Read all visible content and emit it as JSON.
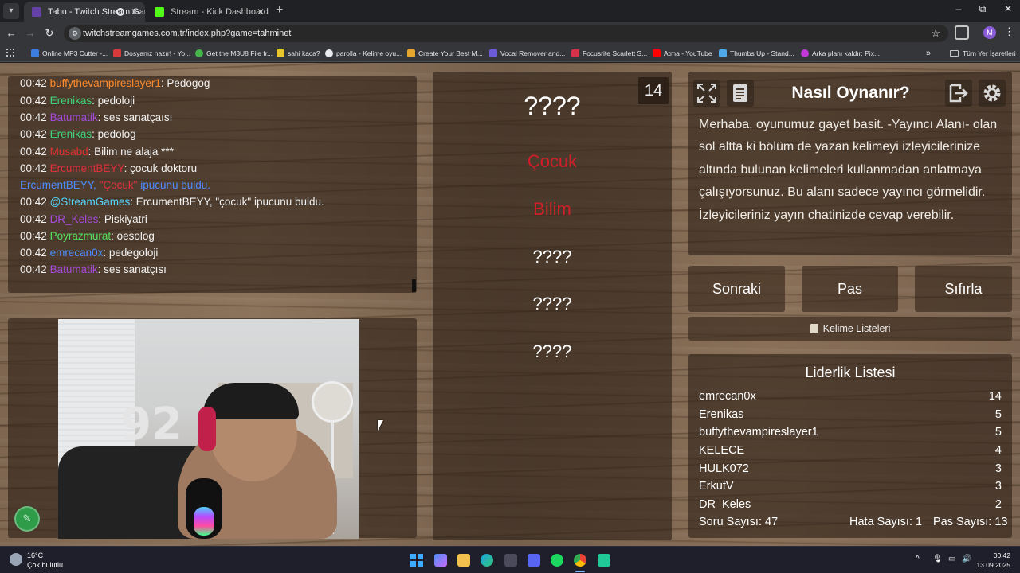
{
  "browser": {
    "tabs": [
      {
        "title": "Tabu - Twitch Stream Games",
        "active": true
      },
      {
        "title": "Stream - Kick Dashboard",
        "active": false
      }
    ],
    "url": "twitchstreamgames.com.tr/index.php?game=tahminet",
    "profile_initial": "M",
    "bookmarks": [
      "Online MP3 Cutter -...",
      "Dosyanız hazır! - Yo...",
      "Get the M3U8 File fr...",
      "sahi kaca?",
      "parolla - Kelime oyu...",
      "Create Your Best M...",
      "Vocal Remover and...",
      "Focusrite Scarlett S...",
      "Atma - YouTube",
      "Thumbs Up - Stand...",
      "Arka planı kaldır: Pix..."
    ],
    "bookmarks_more": "»",
    "all_bookmarks": "Tüm Yer İşaretleri"
  },
  "chat": [
    {
      "time": "00:42",
      "user": "buffythevampireslayer1",
      "color": "#ff8c2e",
      "msg": ": Pedogog"
    },
    {
      "time": "00:42",
      "user": "Erenikas",
      "color": "#3fd37a",
      "msg": ": pedoloji"
    },
    {
      "time": "00:42",
      "user": "Batumatik",
      "color": "#a64bdc",
      "msg": ": ses sanatçaısı"
    },
    {
      "time": "00:42",
      "user": "Erenikas",
      "color": "#3fd37a",
      "msg": ": pedolog"
    },
    {
      "time": "00:42",
      "user": "Musabd",
      "color": "#e0312e",
      "msg": ": Bilim ne alaja ***"
    },
    {
      "time": "00:42",
      "user": "ErcumentBEYY",
      "color": "#e0313c",
      "msg": ": çocuk doktoru"
    },
    {
      "time": "",
      "user": "ErcumentBEYY,",
      "color": "#4c8dff",
      "msg": "",
      "hint_word": "\"Çocuk\"",
      "hint_suffix": " ipucunu buldu."
    },
    {
      "time": "00:42",
      "user": "@StreamGames",
      "color": "#58d6ff",
      "msg": ": ErcumentBEYY, \"çocuk\" ipucunu buldu."
    },
    {
      "time": "00:42",
      "user": "DR_Keles",
      "color": "#a64bdc",
      "msg": ": Piskiyatri"
    },
    {
      "time": "00:42",
      "user": "Poyrazmurat",
      "color": "#53e05a",
      "msg": ": oesolog"
    },
    {
      "time": "00:42",
      "user": "emrecan0x",
      "color": "#4c8dff",
      "msg": ": pedegoloji"
    },
    {
      "time": "00:42",
      "user": "Batumatik",
      "color": "#a64bdc",
      "msg": ": ses sanatçısı"
    }
  ],
  "webcam": {
    "jersey_number": "92"
  },
  "game": {
    "counter": "14",
    "words": [
      {
        "text": "????",
        "state": "hidden"
      },
      {
        "text": "Çocuk",
        "state": "revealed"
      },
      {
        "text": "Bilim",
        "state": "revealed"
      },
      {
        "text": "????",
        "state": "hidden"
      },
      {
        "text": "????",
        "state": "hidden"
      },
      {
        "text": "????",
        "state": "hidden"
      }
    ]
  },
  "how_to": {
    "title": "Nasıl Oynanır?",
    "text": "Merhaba, oyunumuz gayet basit. -Yayıncı Alanı- olan sol altta ki bölüm de yazan kelimeyi izleyicilerinize altında bulunan kelimeleri kullanmadan anlatmaya çalışıyorsunuz. Bu alanı sadece yayıncı görmelidir. İzleyicileriniz yayın chatinizde cevap verebilir."
  },
  "buttons": {
    "next": "Sonraki",
    "pass": "Pas",
    "reset": "Sıfırla",
    "word_lists": "Kelime Listeleri"
  },
  "leaderboard": {
    "title": "Liderlik Listesi",
    "rows": [
      {
        "name": "emrecan0x",
        "score": "14"
      },
      {
        "name": "Erenikas",
        "score": "5"
      },
      {
        "name": "buffythevampireslayer1",
        "score": "5"
      },
      {
        "name": "KELECE",
        "score": "4"
      },
      {
        "name": "HULK072",
        "score": "3"
      },
      {
        "name": "ErkutV",
        "score": "3"
      },
      {
        "name": "DR_Keles",
        "score": "2"
      }
    ]
  },
  "stats": {
    "questions": "Soru Sayısı: 47",
    "errors": "Hata Sayısı: 1",
    "passes": "Pas Sayısı: 13"
  },
  "taskbar": {
    "temp": "16°C",
    "weather": "Çok bulutlu",
    "time": "00:42",
    "date": "13.09.2025"
  }
}
